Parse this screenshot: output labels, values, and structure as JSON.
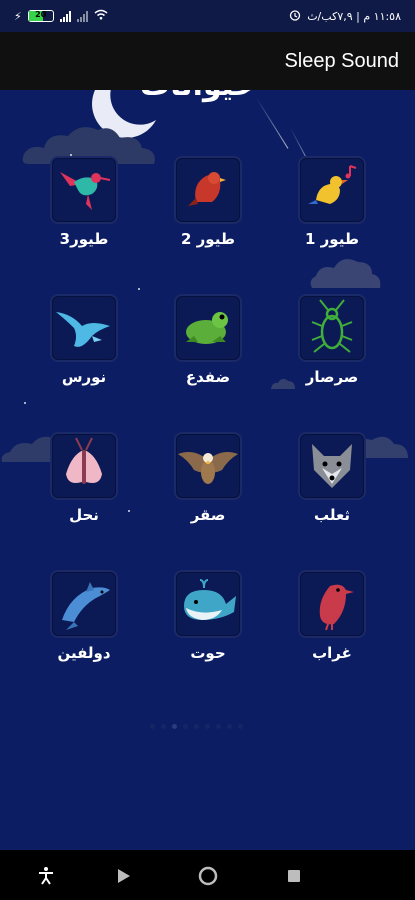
{
  "status_bar": {
    "right_text": "١١:٥٨ م | ٧,٩كب/ث",
    "battery_percent": "20"
  },
  "app_bar": {
    "title": "Sleep Sound"
  },
  "page": {
    "heading": "حيوانات"
  },
  "grid": {
    "items": [
      {
        "label": "طيور3",
        "icon": "hummingbird-icon"
      },
      {
        "label": "طيور 2",
        "icon": "red-bird-icon"
      },
      {
        "label": "طيور 1",
        "icon": "singing-bird-icon"
      },
      {
        "label": "نورس",
        "icon": "seagull-icon"
      },
      {
        "label": "ضفدع",
        "icon": "frog-icon"
      },
      {
        "label": "صرصار",
        "icon": "cricket-icon"
      },
      {
        "label": "نحل",
        "icon": "moth-icon"
      },
      {
        "label": "صقر",
        "icon": "eagle-icon"
      },
      {
        "label": "ثعلب",
        "icon": "wolf-icon"
      },
      {
        "label": "دولفين",
        "icon": "dolphin-icon"
      },
      {
        "label": "حوت",
        "icon": "whale-icon"
      },
      {
        "label": "غراب",
        "icon": "crow-icon"
      }
    ]
  },
  "colors": {
    "background": "#0c1d63",
    "appbar": "#101010",
    "tile_border": "#1b2a66"
  },
  "nav_bar": {
    "icons": [
      "accessibility-icon",
      "play-icon",
      "home-circle-icon",
      "recents-square-icon"
    ]
  }
}
